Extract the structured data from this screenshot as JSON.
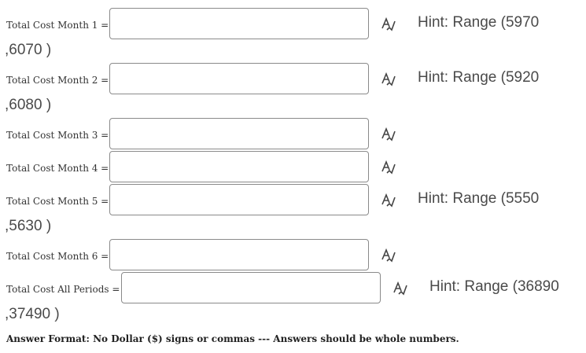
{
  "rows": [
    {
      "label": "Total Cost Month 1 =",
      "value": "",
      "hint": "Hint: Range (5970",
      "hint_cont": ",6070 )"
    },
    {
      "label": "Total Cost Month 2 =",
      "value": "",
      "hint": "Hint: Range (5920",
      "hint_cont": ",6080 )"
    },
    {
      "label": "Total Cost Month 3 =",
      "value": ""
    },
    {
      "label": "Total Cost Month 4 =",
      "value": ""
    },
    {
      "label": "Total Cost Month 5 =",
      "value": "",
      "hint": "Hint: Range (5550",
      "hint_cont": ",5630 )"
    },
    {
      "label": "Total Cost Month 6 =",
      "value": ""
    },
    {
      "label": "Total Cost All Periods =",
      "value": "",
      "hint": "Hint: Range (36890",
      "hint_cont": ",37490 )"
    }
  ],
  "icons": {
    "math_editor": "math-editor-icon"
  },
  "footer": {
    "note": "Answer Format: No Dollar ($) signs or commas --- Answers should be whole numbers."
  }
}
